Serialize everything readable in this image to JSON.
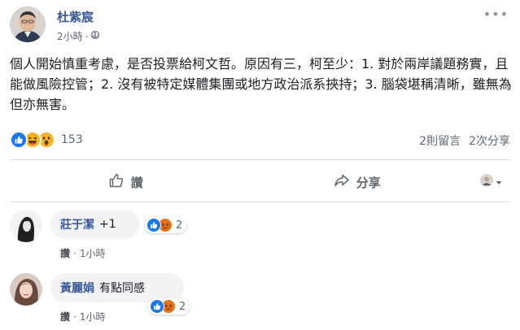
{
  "post": {
    "author": "杜紫宸",
    "time": "2小時",
    "meta_separator": "·",
    "privacy_icon": "globe-icon",
    "body": "個人開始慎重考慮，是否投票給柯文哲。原因有三，柯至少：1. 對於兩岸議題務實，且能做風險控管；2. 沒有被特定媒體集團或地方政治派系挾持；3. 腦袋堪稱清晰，雖無為但亦無害。"
  },
  "reactions": {
    "icons": [
      "like-icon",
      "haha-icon",
      "wow-icon"
    ],
    "count": "153",
    "comments": "2則留言",
    "shares": "2次分享"
  },
  "actions": {
    "like_label": "讚",
    "share_label": "分享"
  },
  "comments": [
    {
      "name": "莊于潔",
      "text": "+1",
      "reaction_icons": [
        "like-icon",
        "angry-icon"
      ],
      "reaction_count": "2",
      "like_label": "讚",
      "separator": "·",
      "time": "1小時"
    },
    {
      "name": "黃麗娟",
      "text": "有點同感",
      "reaction_icons": [
        "like-icon",
        "angry-icon"
      ],
      "reaction_count": "2",
      "like_label": "讚",
      "separator": "·",
      "time": "1小時"
    }
  ],
  "colors": {
    "link": "#385898",
    "like": "#1877f2",
    "haha": "#f7b125",
    "angry": "#e9710f",
    "divider": "#dadde1"
  }
}
